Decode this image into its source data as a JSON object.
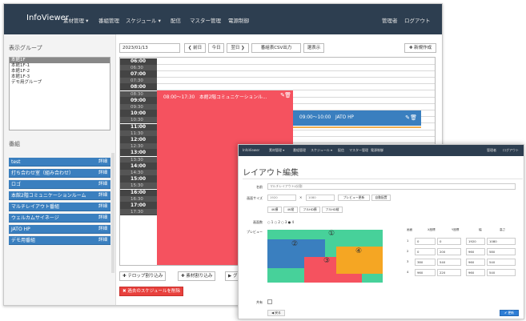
{
  "back": {
    "nav": {
      "brand": "InfoViewer",
      "items": [
        "素材管理 ▾",
        "番組管理",
        "スケジュール ▾",
        "配信",
        "マスター管理",
        "電源制御"
      ],
      "right": [
        "管理者",
        "ログアウト"
      ]
    },
    "sidebar": {
      "group_title": "表示グループ",
      "groups": [
        "本館1F",
        "本館1F-1",
        "本館1F-2",
        "本館1F-3",
        "デモ用グループ"
      ],
      "program_title": "番組",
      "programs": [
        "test",
        "打ち合わせ室（組み合わせ）",
        "ロゴ",
        "本館2階コミュニケーションルーム",
        "マルチレイアウト番組",
        "ウェルカムサイネージ",
        "JATO HP",
        "デモ用番組"
      ],
      "detail_label": "詳細"
    },
    "toolbar": {
      "date": "2023/01/13",
      "prev": "❮ 前日",
      "today": "今日",
      "next": "翌日 ❯",
      "csv": "番組表CSV出力",
      "select": "選表示",
      "new": "✚ 新規作成"
    },
    "times": [
      "06:00",
      "06:30",
      "07:00",
      "07:30",
      "08:00",
      "08:30",
      "09:00",
      "09:30",
      "10:00",
      "10:30",
      "11:00",
      "11:30",
      "12:00",
      "12:30",
      "13:00",
      "13:30",
      "14:00",
      "14:30",
      "15:00",
      "15:30",
      "16:00",
      "16:30",
      "17:00",
      "17:30"
    ],
    "events": {
      "red": "08:00〜17:30　本館2階コミュニケーションル...",
      "blue": "09:00〜10:00　JATO HP"
    },
    "bottom": {
      "telop": "✚ テロップ割り込み",
      "material": "✚ 素材割り込み",
      "group": "▶ グ",
      "delete": "✖ 過去のスケジュールを削除"
    }
  },
  "front": {
    "nav": [
      "InfoViewer",
      "素材管理 ▾",
      "番組管理",
      "スケジュール ▾",
      "配信",
      "マスター管理",
      "電源制御",
      "管理者",
      "ログアウト"
    ],
    "title": "レイアウト編集",
    "labels": {
      "name": "名前",
      "size": "画面サイズ",
      "grid": "画面数",
      "preview": "プレビュー",
      "share": "共有"
    },
    "name_value": "マルチレイアウト4分割",
    "size_w": "1920",
    "size_x": "×",
    "size_h": "1080",
    "size_buttons": [
      "プレビュー更新",
      "自動配置"
    ],
    "presets": [
      "4K横",
      "4K縦",
      "フルHD横",
      "フルHD縦"
    ],
    "grid_options": "○ 1  ○ 2  ○ 3  ● 4",
    "zones": [
      "①",
      "②",
      "③",
      "④"
    ],
    "table_headers": [
      "画面",
      "X座標",
      "Y座標",
      "幅",
      "高さ"
    ],
    "table_rows": [
      [
        "1",
        "0",
        "0",
        "1920",
        "1080"
      ],
      [
        "2",
        "0",
        "200",
        "960",
        "580"
      ],
      [
        "3",
        "380",
        "540",
        "960",
        "540"
      ],
      [
        "4",
        "960",
        "220",
        "960",
        "540"
      ]
    ],
    "back_button": "◀ 戻る",
    "save_button": "✔ 更新"
  }
}
